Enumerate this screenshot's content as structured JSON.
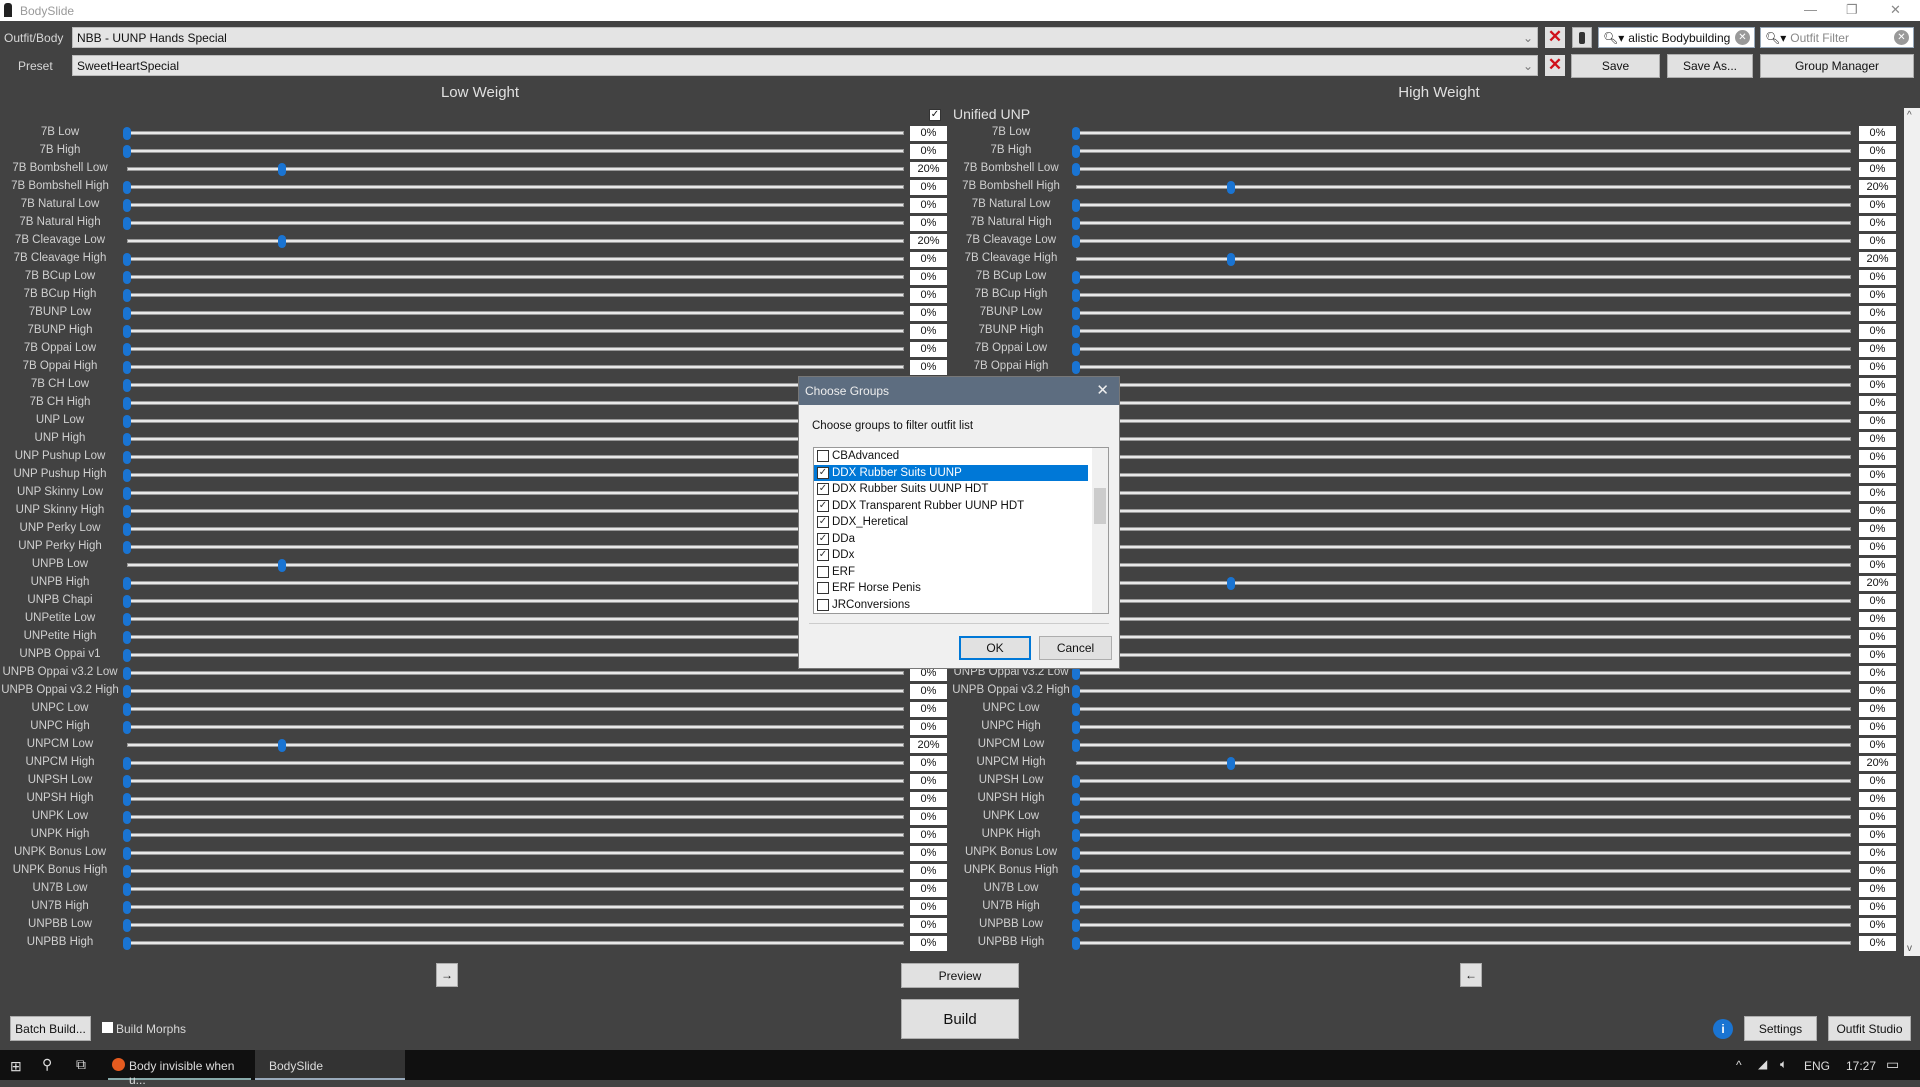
{
  "window": {
    "title": "BodySlide",
    "minimize": "—",
    "restore": "❐",
    "close": "✕"
  },
  "top": {
    "outfit_label": "Outfit/Body",
    "outfit_value": "NBB - UUNP Hands Special",
    "preset_label": "Preset",
    "preset_value": "SweetHeartSpecial",
    "group_filter_value": "alistic Bodybuilding",
    "outfit_filter_placeholder": "Outfit Filter",
    "save": "Save",
    "save_as": "Save As...",
    "group_manager": "Group Manager"
  },
  "headers": {
    "low": "Low Weight",
    "high": "High Weight",
    "unified": "Unified UNP",
    "unified_checked": true
  },
  "sliders": [
    {
      "name": "7B Low",
      "low": 0,
      "high": 0
    },
    {
      "name": "7B High",
      "low": 0,
      "high": 0
    },
    {
      "name": "7B Bombshell Low",
      "low": 20,
      "high": 0
    },
    {
      "name": "7B Bombshell High",
      "low": 0,
      "high": 20
    },
    {
      "name": "7B Natural Low",
      "low": 0,
      "high": 0
    },
    {
      "name": "7B Natural High",
      "low": 0,
      "high": 0
    },
    {
      "name": "7B Cleavage Low",
      "low": 20,
      "high": 0
    },
    {
      "name": "7B Cleavage High",
      "low": 0,
      "high": 20
    },
    {
      "name": "7B BCup Low",
      "low": 0,
      "high": 0
    },
    {
      "name": "7B BCup High",
      "low": 0,
      "high": 0
    },
    {
      "name": "7BUNP Low",
      "low": 0,
      "high": 0
    },
    {
      "name": "7BUNP High",
      "low": 0,
      "high": 0
    },
    {
      "name": "7B Oppai Low",
      "low": 0,
      "high": 0
    },
    {
      "name": "7B Oppai High",
      "low": 0,
      "high": 0
    },
    {
      "name": "7B CH Low",
      "low": 0,
      "high": 0
    },
    {
      "name": "7B CH High",
      "low": 0,
      "high": 0
    },
    {
      "name": "UNP Low",
      "low": 0,
      "high": 0
    },
    {
      "name": "UNP High",
      "low": 0,
      "high": 0
    },
    {
      "name": "UNP Pushup Low",
      "low": 0,
      "high": 0
    },
    {
      "name": "UNP Pushup High",
      "low": 0,
      "high": 0
    },
    {
      "name": "UNP Skinny Low",
      "low": 0,
      "high": 0
    },
    {
      "name": "UNP Skinny High",
      "low": 0,
      "high": 0
    },
    {
      "name": "UNP Perky Low",
      "low": 0,
      "high": 0
    },
    {
      "name": "UNP Perky High",
      "low": 0,
      "high": 0
    },
    {
      "name": "UNPB Low",
      "low": 20,
      "high": 0
    },
    {
      "name": "UNPB High",
      "low": 0,
      "high": 20
    },
    {
      "name": "UNPB Chapi",
      "low": 0,
      "high": 0
    },
    {
      "name": "UNPetite Low",
      "low": 0,
      "high": 0
    },
    {
      "name": "UNPetite High",
      "low": 0,
      "high": 0
    },
    {
      "name": "UNPB Oppai v1",
      "low": 0,
      "high": 0
    },
    {
      "name": "UNPB Oppai v3.2 Low",
      "low": 0,
      "high": 0
    },
    {
      "name": "UNPB Oppai v3.2 High",
      "low": 0,
      "high": 0
    },
    {
      "name": "UNPC Low",
      "low": 0,
      "high": 0
    },
    {
      "name": "UNPC High",
      "low": 0,
      "high": 0
    },
    {
      "name": "UNPCM Low",
      "low": 20,
      "high": 0
    },
    {
      "name": "UNPCM High",
      "low": 0,
      "high": 20
    },
    {
      "name": "UNPSH Low",
      "low": 0,
      "high": 0
    },
    {
      "name": "UNPSH High",
      "low": 0,
      "high": 0
    },
    {
      "name": "UNPK Low",
      "low": 0,
      "high": 0
    },
    {
      "name": "UNPK High",
      "low": 0,
      "high": 0
    },
    {
      "name": "UNPK Bonus Low",
      "low": 0,
      "high": 0
    },
    {
      "name": "UNPK Bonus High",
      "low": 0,
      "high": 0
    },
    {
      "name": "UN7B Low",
      "low": 0,
      "high": 0
    },
    {
      "name": "UN7B High",
      "low": 0,
      "high": 0
    },
    {
      "name": "UNPBB Low",
      "low": 0,
      "high": 0
    },
    {
      "name": "UNPBB High",
      "low": 0,
      "high": 0
    }
  ],
  "bottom": {
    "arrow_left": "→",
    "arrow_right": "←",
    "preview": "Preview",
    "build": "Build",
    "batch_build": "Batch Build...",
    "build_morphs": "Build Morphs",
    "settings": "Settings",
    "outfit_studio": "Outfit Studio"
  },
  "dialog": {
    "title": "Choose Groups",
    "prompt": "Choose groups to filter outfit list",
    "ok": "OK",
    "cancel": "Cancel",
    "groups": [
      {
        "label": "CBAdvanced",
        "checked": false
      },
      {
        "label": "DDX Rubber Suits UUNP",
        "checked": true,
        "selected": true
      },
      {
        "label": "DDX Rubber Suits UUNP HDT",
        "checked": true
      },
      {
        "label": "DDX Transparent Rubber UUNP HDT",
        "checked": true
      },
      {
        "label": "DDX_Heretical",
        "checked": true
      },
      {
        "label": "DDa",
        "checked": true
      },
      {
        "label": "DDx",
        "checked": true
      },
      {
        "label": "ERF",
        "checked": false
      },
      {
        "label": "ERF Horse Penis",
        "checked": false
      },
      {
        "label": "JRConversions",
        "checked": false
      }
    ]
  },
  "taskbar": {
    "app1": "Body invisible when u...",
    "app2": "BodySlide",
    "lang": "ENG",
    "time": "17:27"
  },
  "colors": {
    "background": "#424242",
    "accent": "#1a74d2",
    "clear_red": "#d0101a"
  }
}
